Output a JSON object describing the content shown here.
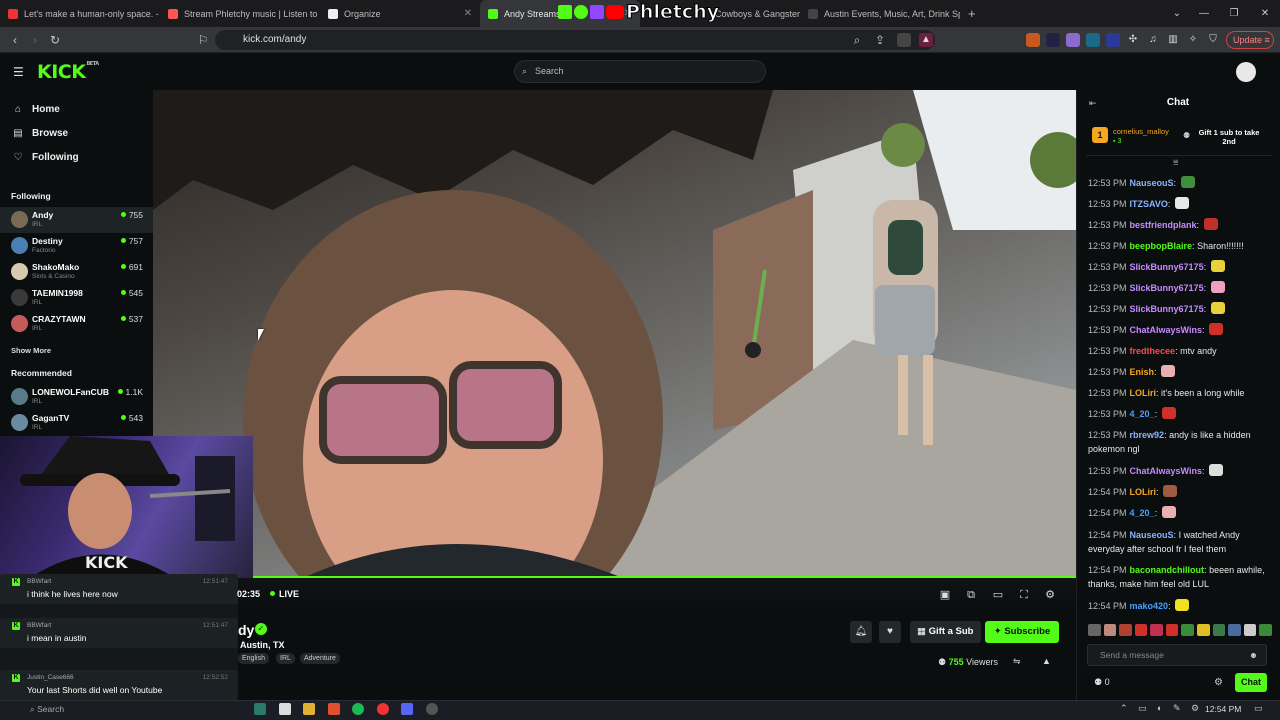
{
  "browser": {
    "tabs": [
      {
        "label": "Let's make a human-only space. - Yo",
        "color": "#e33"
      },
      {
        "label": "Stream Phletchy music | Listen to so",
        "color": "#f55"
      },
      {
        "label": "Organize",
        "color": "#eee"
      },
      {
        "label": "Andy Streams",
        "color": "#53fc18"
      },
      {
        "label": "Cowboys & Gangsters",
        "color": "#888"
      },
      {
        "label": "Austin Events, Music, Art, Drink Spe",
        "color": "#444"
      }
    ],
    "overlay_logo": "Phletchy",
    "url": "kick.com/andy",
    "update_label": "Update",
    "new_tab": "+"
  },
  "kick": {
    "logo": "KICK",
    "logo_tag": "BETA",
    "search_placeholder": "Search"
  },
  "sidebar": {
    "nav": [
      {
        "label": "Home",
        "icon": "home-icon"
      },
      {
        "label": "Browse",
        "icon": "browse-icon"
      },
      {
        "label": "Following",
        "icon": "heart-icon"
      }
    ],
    "following_heading": "Following",
    "following": [
      {
        "name": "Andy",
        "category": "IRL",
        "viewers": "755",
        "color": "#7a6a55"
      },
      {
        "name": "Destiny",
        "category": "Factorio",
        "viewers": "757",
        "color": "#4a7fb5"
      },
      {
        "name": "ShakoMako",
        "category": "Slots & Casino",
        "viewers": "691",
        "color": "#d9c7b0"
      },
      {
        "name": "TAEMIN1998",
        "category": "IRL",
        "viewers": "545",
        "color": "#3a3a3a"
      },
      {
        "name": "CRAZYTAWN",
        "category": "IRL",
        "viewers": "537",
        "color": "#c65a5a"
      }
    ],
    "show_more": "Show More",
    "recommended_heading": "Recommended",
    "recommended": [
      {
        "name": "LONEWOLFanCUB",
        "category": "IRL",
        "viewers": "1.1K",
        "color": "#5a7a8a"
      },
      {
        "name": "GaganTV",
        "category": "IRL",
        "viewers": "543",
        "color": "#6a8aa0"
      }
    ]
  },
  "player": {
    "timecode": "02:35",
    "live": "LIVE"
  },
  "stream": {
    "streamer": "Andy",
    "streamer_visible": "dy",
    "location": "Austin, TX",
    "tags": [
      "English",
      "IRL",
      "Adventure"
    ],
    "gift_label": "Gift a Sub",
    "subscribe_label": "Subscribe",
    "viewers_count": "755",
    "viewers_label": "Viewers"
  },
  "cam_chat": [
    {
      "user": "BBWfart",
      "time": "12:51:47",
      "text": "i think he lives here now"
    },
    {
      "user": "BBWfart",
      "time": "12:51:47",
      "text": "i mean in austin"
    },
    {
      "user": "Justin_Case666",
      "time": "12:52:52",
      "text": "Your last Shorts did well on Youtube"
    }
  ],
  "chat": {
    "title": "Chat",
    "pinned_user": "cornelius_malloy",
    "pinned_count": "3",
    "pinned_cta": "Gift 1 sub to take 2nd",
    "messages": [
      {
        "time": "12:53 PM",
        "user": "NauseouS",
        "color": "#8ab4ff",
        "text": "",
        "emote": "#3f8f3f"
      },
      {
        "time": "12:53 PM",
        "user": "ITZSAVO",
        "color": "#8ab4ff",
        "text": "",
        "emote": "#e8e8e8"
      },
      {
        "time": "12:53 PM",
        "user": "bestfriendplank",
        "color": "#c58bff",
        "text": "",
        "emote": "#c0302a"
      },
      {
        "time": "12:53 PM",
        "user": "beepbopBlaire",
        "color": "#53fc18",
        "text": "Sharon!!!!!!!",
        "emote": ""
      },
      {
        "time": "12:53 PM",
        "user": "SlickBunny67175",
        "color": "#c58bff",
        "text": "",
        "emote": "#e8d23a"
      },
      {
        "time": "12:53 PM",
        "user": "SlickBunny67175",
        "color": "#c58bff",
        "text": "",
        "emote": "#f0a0c0"
      },
      {
        "time": "12:53 PM",
        "user": "SlickBunny67175",
        "color": "#c58bff",
        "text": "",
        "emote": "#e8d23a"
      },
      {
        "time": "12:53 PM",
        "user": "ChatAlwaysWins",
        "color": "#c58bff",
        "text": "",
        "emote": "#d0302a"
      },
      {
        "time": "12:53 PM",
        "user": "fredthecee",
        "color": "#ff4a4a",
        "text": "mtv andy",
        "emote": ""
      },
      {
        "time": "12:53 PM",
        "user": "Enish",
        "color": "#f5a623",
        "text": "",
        "emote": "#e8b0b0"
      },
      {
        "time": "12:53 PM",
        "user": "LOLiri",
        "color": "#f5a623",
        "text": "it's been a long while",
        "emote": ""
      },
      {
        "time": "12:53 PM",
        "user": "4_20_",
        "color": "#4a9fff",
        "text": "",
        "emote": "#d0302a"
      },
      {
        "time": "12:53 PM",
        "user": "rbrew92",
        "color": "#8ab4ff",
        "text": "andy is like a hidden pokemon ngl",
        "emote": ""
      },
      {
        "time": "12:53 PM",
        "user": "ChatAlwaysWins",
        "color": "#c58bff",
        "text": "",
        "emote": "#dddddd"
      },
      {
        "time": "12:54 PM",
        "user": "LOLiri",
        "color": "#f5a623",
        "text": "",
        "emote": "#a05a40"
      },
      {
        "time": "12:54 PM",
        "user": "4_20_",
        "color": "#4a9fff",
        "text": "",
        "emote": "#e8b0b0"
      },
      {
        "time": "12:54 PM",
        "user": "NauseouS",
        "color": "#8ab4ff",
        "text": "I watched Andy everyday after school fr I feel them",
        "emote": ""
      },
      {
        "time": "12:54 PM",
        "user": "baconandchillout",
        "color": "#53fc18",
        "text": "beeen awhile, thanks, make him feel old LUL",
        "emote": ""
      },
      {
        "time": "12:54 PM",
        "user": "mako420",
        "color": "#4a9fff",
        "text": "",
        "emote": "#f0e020"
      }
    ],
    "input_placeholder": "Send a message",
    "points": "0",
    "send_label": "Chat"
  },
  "taskbar": {
    "search": "Search",
    "clock": "12:54 PM"
  }
}
